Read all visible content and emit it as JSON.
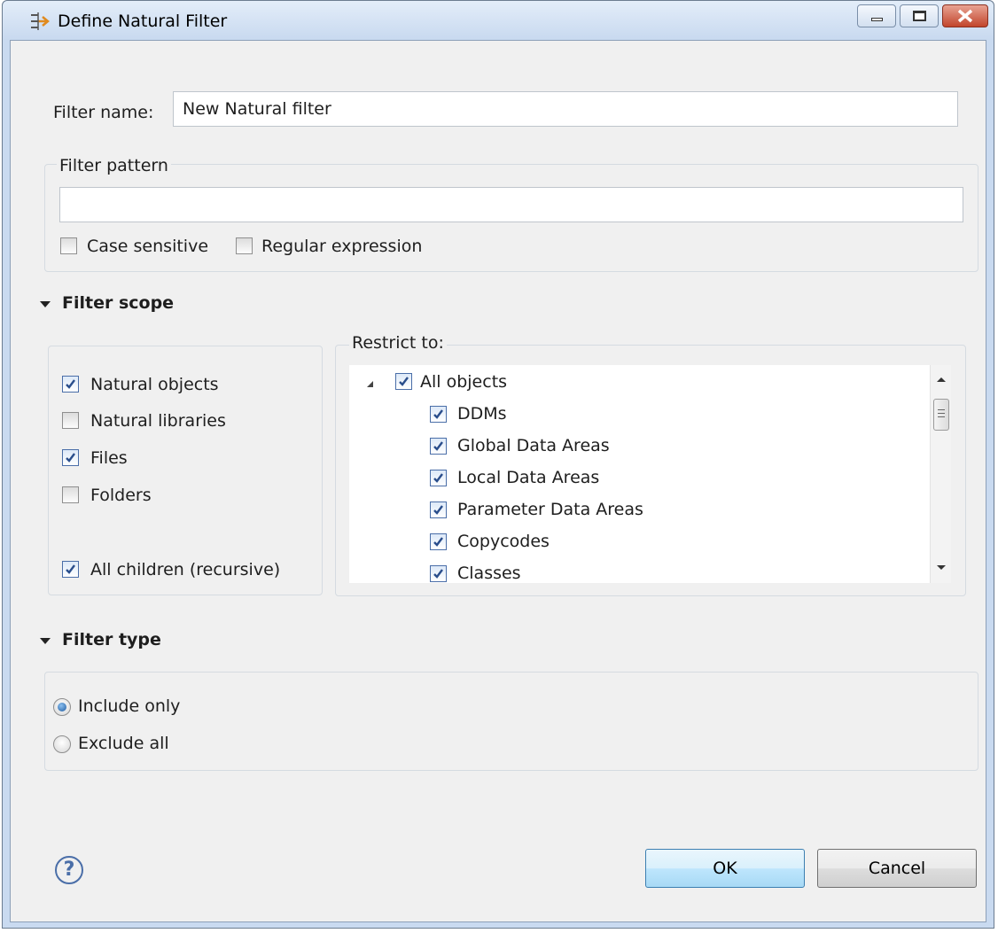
{
  "window": {
    "title": "Define Natural Filter"
  },
  "filter_name": {
    "label": "Filter name:",
    "value": "New Natural filter"
  },
  "filter_pattern": {
    "group_title": "Filter pattern",
    "value": "",
    "case_sensitive": {
      "label": "Case sensitive",
      "checked": false
    },
    "regular_expression": {
      "label": "Regular expression",
      "checked": false
    }
  },
  "filter_scope": {
    "heading": "Filter scope",
    "options": [
      {
        "label": "Natural objects",
        "checked": true
      },
      {
        "label": "Natural libraries",
        "checked": false
      },
      {
        "label": "Files",
        "checked": true
      },
      {
        "label": "Folders",
        "checked": false
      }
    ],
    "all_children": {
      "label": "All children (recursive)",
      "checked": true
    },
    "restrict_to": {
      "title": "Restrict to:",
      "root": {
        "label": "All objects",
        "checked": true,
        "expanded": true
      },
      "items": [
        {
          "label": "DDMs",
          "checked": true
        },
        {
          "label": "Global Data Areas",
          "checked": true
        },
        {
          "label": "Local Data Areas",
          "checked": true
        },
        {
          "label": "Parameter Data Areas",
          "checked": true
        },
        {
          "label": "Copycodes",
          "checked": true
        },
        {
          "label": "Classes",
          "checked": true
        }
      ]
    }
  },
  "filter_type": {
    "heading": "Filter type",
    "options": [
      {
        "label": "Include only",
        "selected": true
      },
      {
        "label": "Exclude all",
        "selected": false
      }
    ]
  },
  "buttons": {
    "ok": "OK",
    "cancel": "Cancel"
  },
  "icons": {
    "title": "filter-icon",
    "help": "help-icon",
    "minimize": "minimize-icon",
    "maximize": "maximize-icon",
    "close": "close-icon"
  },
  "colors": {
    "accent": "#4a6ea8",
    "default_button": "#3c7fb1",
    "close_button": "#c2452c"
  }
}
